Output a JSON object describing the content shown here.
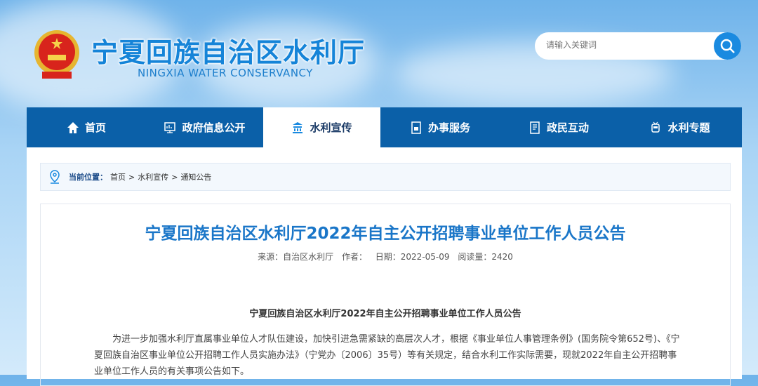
{
  "header": {
    "title": "宁夏回族自治区水利厅",
    "subtitle": "NINGXIA WATER CONSERVANCY",
    "search_placeholder": "请输入关键词"
  },
  "nav": [
    {
      "label": "首页",
      "icon": "home-icon"
    },
    {
      "label": "政府信息公开",
      "icon": "monitor-icon"
    },
    {
      "label": "水利宣传",
      "icon": "building-icon",
      "active": true
    },
    {
      "label": "办事服务",
      "icon": "document-icon"
    },
    {
      "label": "政民互动",
      "icon": "list-icon"
    },
    {
      "label": "水利专题",
      "icon": "train-icon"
    }
  ],
  "breadcrumb": {
    "label": "当前位置：",
    "items": [
      "首页",
      "水利宣传",
      "通知公告"
    ],
    "sep": ">"
  },
  "article": {
    "title": "宁夏回族自治区水利厅2022年自主公开招聘事业单位工作人员公告",
    "meta": {
      "source": "来源：自治区水利厅",
      "author": "作者：",
      "date": "日期：2022-05-09",
      "views": "阅读量：2420"
    },
    "subtitle": "宁夏回族自治区水利厅2022年自主公开招聘事业单位工作人员公告",
    "body": "为进一步加强水利厅直属事业单位人才队伍建设，加快引进急需紧缺的高层次人才，根据《事业单位人事管理条例》(国务院令第652号)、《宁夏回族自治区事业单位公开招聘工作人员实施办法》（宁党办〔2006〕35号）等有关规定，结合水利工作实际需要，现就2022年自主公开招聘事业单位工作人员的有关事项公告如下。"
  }
}
